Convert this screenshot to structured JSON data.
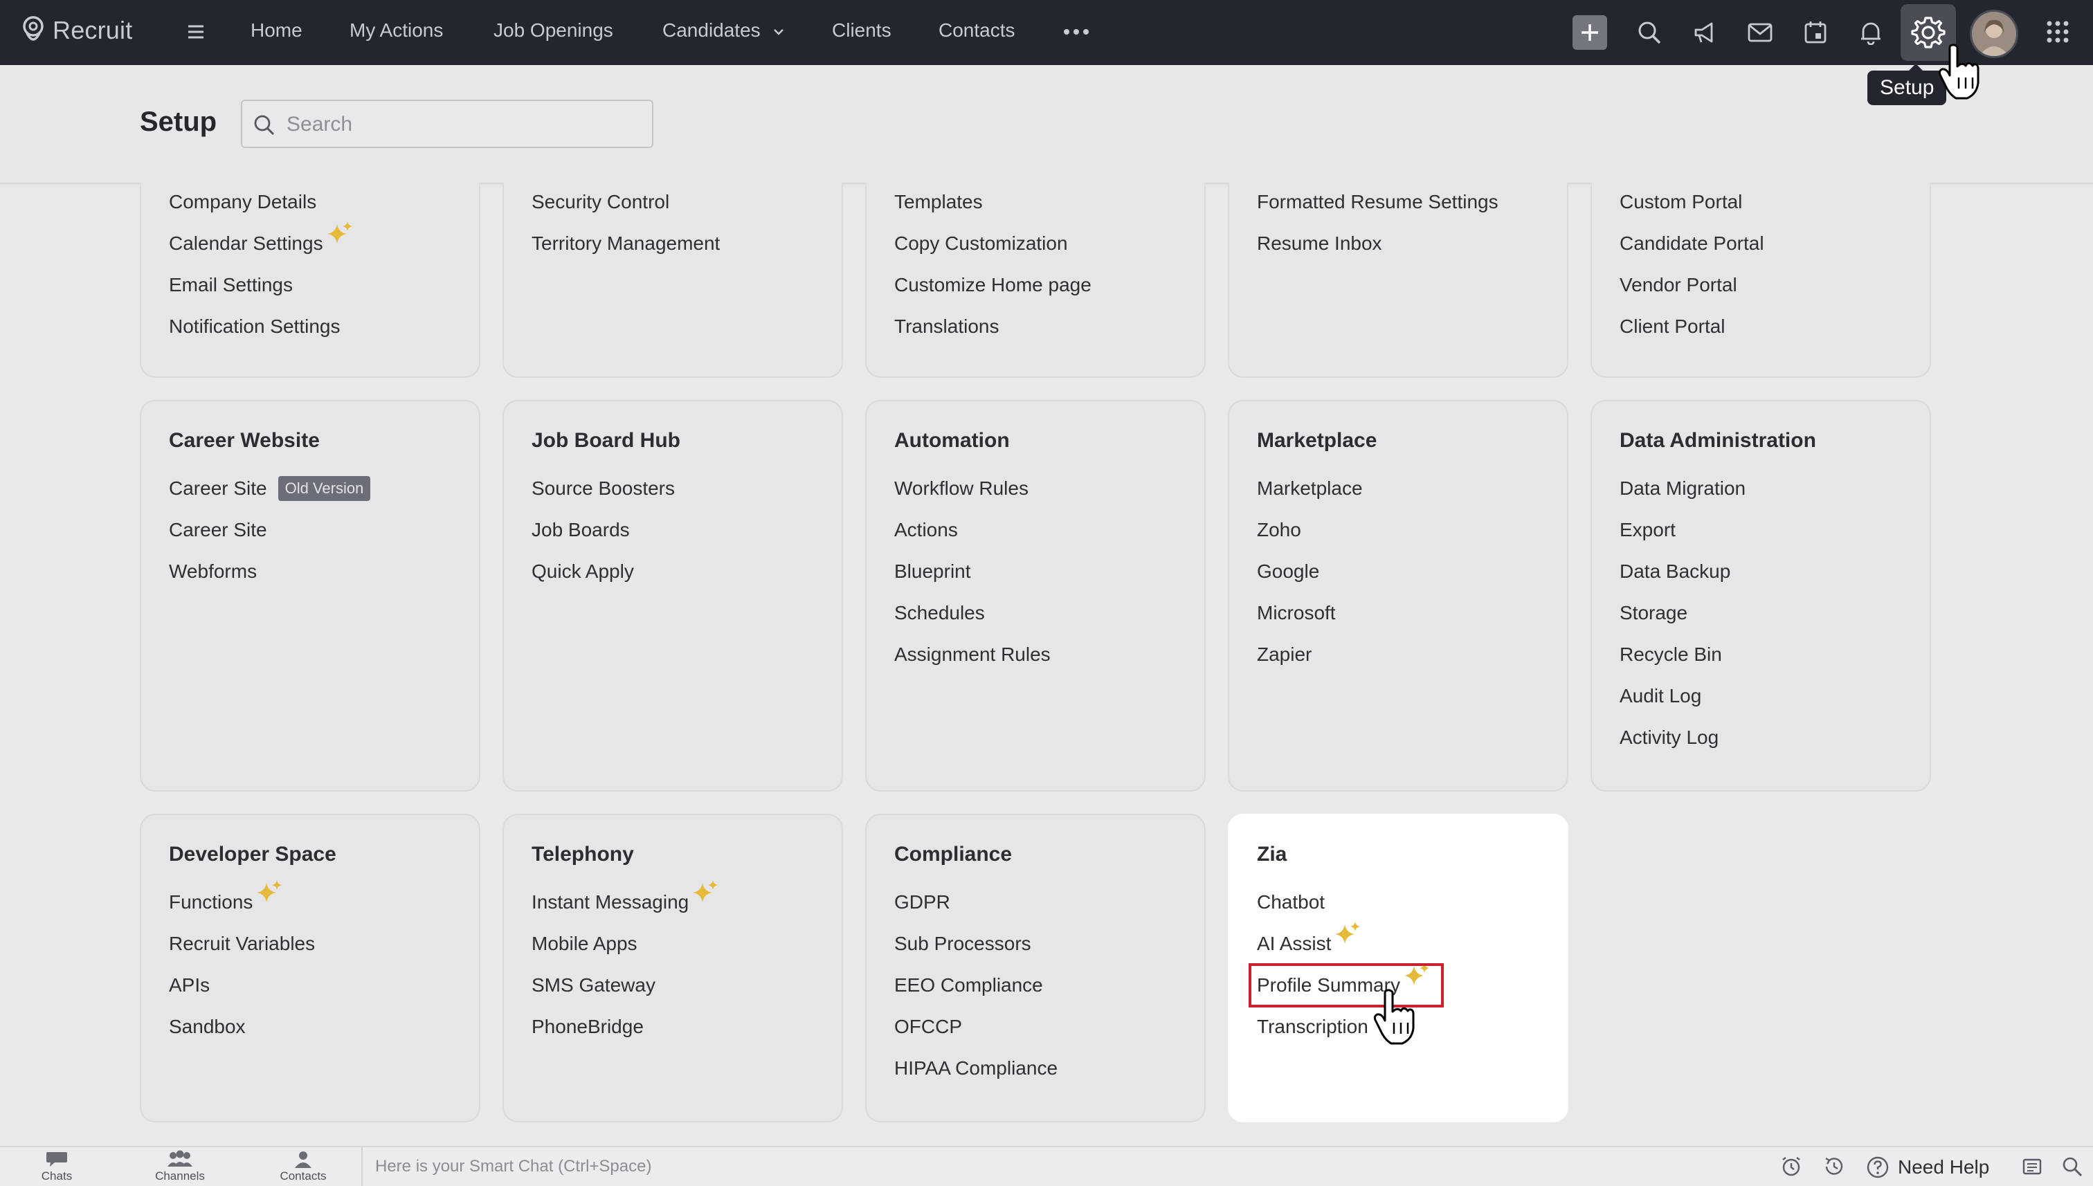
{
  "topbar": {
    "logo_text": "Recruit",
    "nav": [
      "Home",
      "My Actions",
      "Job Openings",
      "Candidates",
      "Clients",
      "Contacts"
    ],
    "icons": [
      "menu-icon",
      "more-icon",
      "plus-icon",
      "search-icon",
      "megaphone-icon",
      "mail-icon",
      "calendar-icon",
      "bell-icon",
      "gear-icon",
      "avatar",
      "apps-grid-icon"
    ]
  },
  "setup": {
    "title": "Setup",
    "search_placeholder": "Search",
    "tooltip": "Setup"
  },
  "cards_top": [
    {
      "items": [
        "Company Details",
        "Calendar Settings",
        "Email Settings",
        "Notification Settings"
      ]
    },
    {
      "items": [
        "Security Control",
        "Territory Management"
      ]
    },
    {
      "items": [
        "Templates",
        "Copy Customization",
        "Customize Home page",
        "Translations"
      ]
    },
    {
      "items": [
        "Formatted Resume Settings",
        "Resume Inbox"
      ]
    },
    {
      "items": [
        "Custom Portal",
        "Candidate Portal",
        "Vendor Portal",
        "Client Portal"
      ]
    }
  ],
  "cards_mid": [
    {
      "title": "Career Website",
      "items": [
        "Career Site",
        "Career Site",
        "Webforms"
      ],
      "badge": "Old Version"
    },
    {
      "title": "Job Board Hub",
      "items": [
        "Source Boosters",
        "Job Boards",
        "Quick Apply"
      ]
    },
    {
      "title": "Automation",
      "items": [
        "Workflow Rules",
        "Actions",
        "Blueprint",
        "Schedules",
        "Assignment Rules"
      ]
    },
    {
      "title": "Marketplace",
      "items": [
        "Marketplace",
        "Zoho",
        "Google",
        "Microsoft",
        "Zapier"
      ]
    },
    {
      "title": "Data Administration",
      "items": [
        "Data Migration",
        "Export",
        "Data Backup",
        "Storage",
        "Recycle Bin",
        "Audit Log",
        "Activity Log"
      ]
    }
  ],
  "cards_bottom": [
    {
      "title": "Developer Space",
      "items": [
        "Functions",
        "Recruit Variables",
        "APIs",
        "Sandbox"
      ]
    },
    {
      "title": "Telephony",
      "items": [
        "Instant Messaging",
        "Mobile Apps",
        "SMS Gateway",
        "PhoneBridge"
      ]
    },
    {
      "title": "Compliance",
      "items": [
        "GDPR",
        "Sub Processors",
        "EEO Compliance",
        "OFCCP",
        "HIPAA Compliance"
      ]
    },
    {
      "title": "Zia",
      "items": [
        "Chatbot",
        "AI Assist",
        "Profile Summary",
        "Transcription"
      ]
    }
  ],
  "bottombar": {
    "items": [
      "Chats",
      "Channels",
      "Contacts"
    ],
    "smart_chat": "Here is your Smart Chat (Ctrl+Space)",
    "need_help": "Need Help"
  },
  "colors": {
    "topbar": "#23252f",
    "sparkle": "#e5b93a",
    "highlight": "#c8232c",
    "badge": "#6b6e79"
  }
}
